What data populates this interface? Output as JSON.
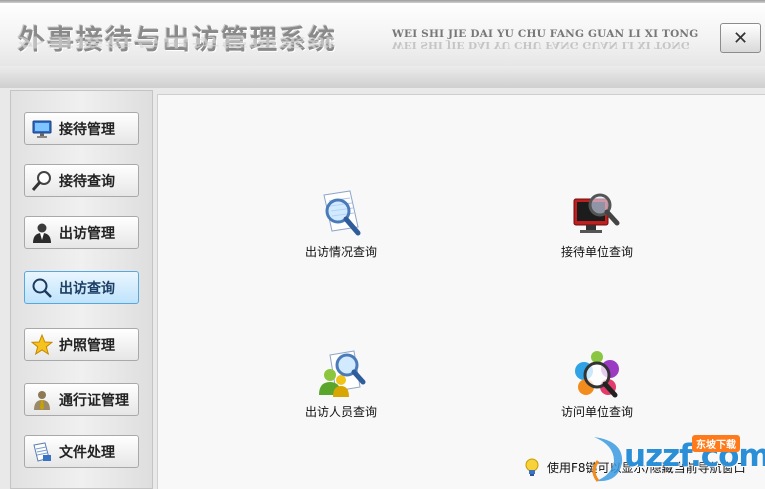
{
  "header": {
    "title": "外事接待与出访管理系统",
    "pinyin": "WEI SHI JIE DAI YU CHU FANG GUAN LI XI TONG",
    "close_label": "✕"
  },
  "sidebar": {
    "items": [
      {
        "label": "接待管理",
        "icon": "monitor-icon"
      },
      {
        "label": "接待查询",
        "icon": "magnifier-icon"
      },
      {
        "label": "出访管理",
        "icon": "person-icon"
      },
      {
        "label": "出访查询",
        "icon": "search-icon",
        "active": true
      },
      {
        "label": "护照管理",
        "icon": "star-icon"
      },
      {
        "label": "通行证管理",
        "icon": "tie-icon"
      },
      {
        "label": "文件处理",
        "icon": "document-icon"
      }
    ]
  },
  "main": {
    "tiles": [
      {
        "label": "出访情况查询",
        "icon": "document-search-icon"
      },
      {
        "label": "接待单位查询",
        "icon": "monitor-search-icon"
      },
      {
        "label": "出访人员查询",
        "icon": "people-search-icon"
      },
      {
        "label": "访问单位查询",
        "icon": "colorful-search-icon"
      }
    ]
  },
  "status": {
    "text": "使用F8键可以显示/隐藏当前导航窗口"
  },
  "watermark": {
    "text": "uzzf.com",
    "badge": "东坡下载"
  },
  "colors": {
    "active_border": "#58a8de",
    "watermark_blue": "#2a8fd6"
  }
}
